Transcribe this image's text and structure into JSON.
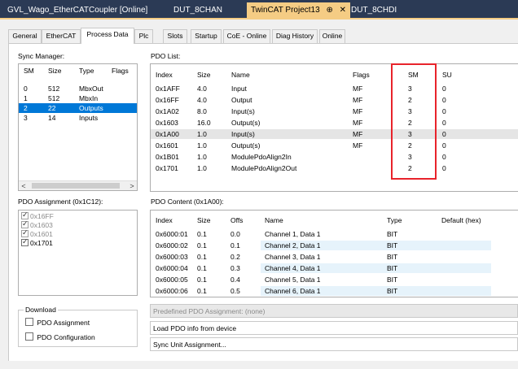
{
  "doc_tabs": [
    {
      "label": "GVL_Wago_EtherCATCoupler [Online]",
      "active": false
    },
    {
      "label": "DUT_8CHAN",
      "active": false
    },
    {
      "label": "TwinCAT Project13",
      "active": true
    },
    {
      "label": "DUT_8CHDI",
      "active": false
    }
  ],
  "doc_tab_icons": {
    "pin": "⊕",
    "close": "✕"
  },
  "prop_tabs": [
    "General",
    "EtherCAT",
    "Process Data",
    "Plc",
    "Slots",
    "Startup",
    "CoE - Online",
    "Diag History",
    "Online"
  ],
  "active_prop_tab": "Process Data",
  "sync_manager": {
    "label": "Sync Manager:",
    "columns": [
      "SM",
      "Size",
      "Type",
      "Flags"
    ],
    "rows": [
      {
        "sm": "0",
        "size": "512",
        "type": "MbxOut",
        "flags": "",
        "selected": false
      },
      {
        "sm": "1",
        "size": "512",
        "type": "MbxIn",
        "flags": "",
        "selected": false
      },
      {
        "sm": "2",
        "size": "22",
        "type": "Outputs",
        "flags": "",
        "selected": true
      },
      {
        "sm": "3",
        "size": "14",
        "type": "Inputs",
        "flags": "",
        "selected": false
      }
    ]
  },
  "pdo_list": {
    "label": "PDO List:",
    "columns": [
      "Index",
      "Size",
      "Name",
      "Flags",
      "SM",
      "SU"
    ],
    "rows": [
      {
        "index": "0x1AFF",
        "size": "4.0",
        "name": "Input",
        "flags": "MF",
        "sm": "3",
        "su": "0"
      },
      {
        "index": "0x16FF",
        "size": "4.0",
        "name": "Output",
        "flags": "MF",
        "sm": "2",
        "su": "0"
      },
      {
        "index": "0x1A02",
        "size": "8.0",
        "name": "Input(s)",
        "flags": "MF",
        "sm": "3",
        "su": "0"
      },
      {
        "index": "0x1603",
        "size": "16.0",
        "name": "Output(s)",
        "flags": "MF",
        "sm": "2",
        "su": "0"
      },
      {
        "index": "0x1A00",
        "size": "1.0",
        "name": "Input(s)",
        "flags": "MF",
        "sm": "3",
        "su": "0"
      },
      {
        "index": "0x1601",
        "size": "1.0",
        "name": "Output(s)",
        "flags": "MF",
        "sm": "2",
        "su": "0"
      },
      {
        "index": "0x1B01",
        "size": "1.0",
        "name": "ModulePdoAlign2In",
        "flags": "",
        "sm": "3",
        "su": "0"
      },
      {
        "index": "0x1701",
        "size": "1.0",
        "name": "ModulePdoAlign2Out",
        "flags": "",
        "sm": "2",
        "su": "0"
      }
    ],
    "highlighted_row": 4
  },
  "pdo_assignment": {
    "label": "PDO Assignment (0x1C12):",
    "items": [
      {
        "label": "0x16FF",
        "checked": true,
        "disabled": true
      },
      {
        "label": "0x1603",
        "checked": true,
        "disabled": true
      },
      {
        "label": "0x1601",
        "checked": true,
        "disabled": true
      },
      {
        "label": "0x1701",
        "checked": true,
        "disabled": false
      }
    ]
  },
  "pdo_content": {
    "label": "PDO Content (0x1A00):",
    "columns": [
      "Index",
      "Size",
      "Offs",
      "Name",
      "Type",
      "Default (hex)"
    ],
    "rows": [
      {
        "index": "0x6000:01",
        "size": "0.1",
        "offs": "0.0",
        "name": "Channel 1, Data 1",
        "type": "BIT",
        "default": ""
      },
      {
        "index": "0x6000:02",
        "size": "0.1",
        "offs": "0.1",
        "name": "Channel 2, Data 1",
        "type": "BIT",
        "default": ""
      },
      {
        "index": "0x6000:03",
        "size": "0.1",
        "offs": "0.2",
        "name": "Channel 3, Data 1",
        "type": "BIT",
        "default": ""
      },
      {
        "index": "0x6000:04",
        "size": "0.1",
        "offs": "0.3",
        "name": "Channel 4, Data 1",
        "type": "BIT",
        "default": ""
      },
      {
        "index": "0x6000:05",
        "size": "0.1",
        "offs": "0.4",
        "name": "Channel 5, Data 1",
        "type": "BIT",
        "default": ""
      },
      {
        "index": "0x6000:06",
        "size": "0.1",
        "offs": "0.5",
        "name": "Channel 6, Data 1",
        "type": "BIT",
        "default": ""
      }
    ]
  },
  "download": {
    "title": "Download",
    "options": [
      {
        "label": "PDO Assignment",
        "checked": false
      },
      {
        "label": "PDO Configuration",
        "checked": false
      }
    ]
  },
  "buttons": {
    "predefined": "Predefined PDO Assignment: (none)",
    "load_pdo": "Load PDO info from device",
    "sync_unit": "Sync Unit Assignment..."
  },
  "scroll_icons": {
    "left": "<",
    "right": ">"
  },
  "colors": {
    "doc_tab_bar": "#2b3a55",
    "active_doc_tab": "#f5cc84",
    "selection": "#0078d7",
    "highlight_row": "#e5e5e5",
    "alt_row": "#e6f3fb",
    "annotation_box": "#e8232b"
  }
}
